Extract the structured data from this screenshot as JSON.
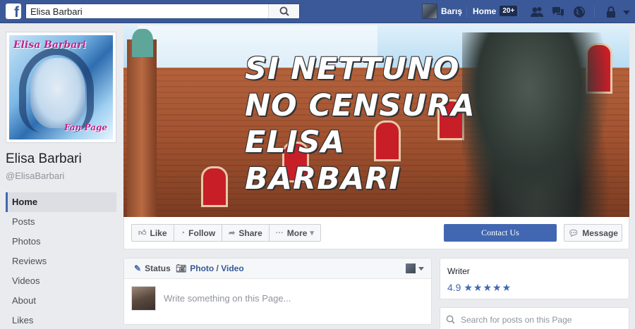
{
  "topbar": {
    "search_value": "Elisa Barbari",
    "user_name": "Barış",
    "home_label": "Home",
    "home_badge": "20+"
  },
  "page": {
    "profile_title": "Elisa Barbari",
    "profile_subtitle": "Fan Page",
    "name": "Elisa Barbari",
    "handle": "@ElisaBarbari"
  },
  "sidebar": {
    "items": [
      {
        "label": "Home",
        "active": true
      },
      {
        "label": "Posts"
      },
      {
        "label": "Photos"
      },
      {
        "label": "Reviews"
      },
      {
        "label": "Videos"
      },
      {
        "label": "About"
      },
      {
        "label": "Likes"
      }
    ]
  },
  "cover": {
    "lines": [
      "SI NETTUNO",
      "NO CENSURA",
      "ELISA",
      "BARBARI"
    ]
  },
  "actions": {
    "like": "Like",
    "follow": "Follow",
    "share": "Share",
    "more": "More",
    "contact": "Contact Us",
    "message": "Message"
  },
  "composer": {
    "status_tab": "Status",
    "photo_tab": "Photo / Video",
    "placeholder": "Write something on this Page..."
  },
  "about": {
    "category": "Writer",
    "rating": "4.9",
    "stars": "★★★★★"
  },
  "search_posts": {
    "placeholder": "Search for posts on this Page"
  },
  "colors": {
    "brand": "#3b5998",
    "accent": "#4267b2"
  }
}
